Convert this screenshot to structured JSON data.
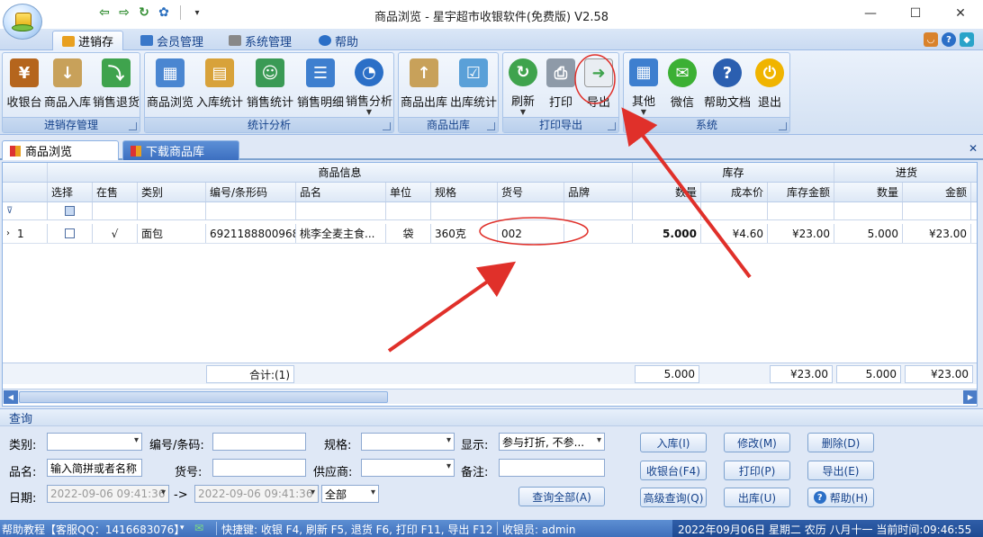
{
  "window": {
    "title": "商品浏览 - 星宇超市收银软件(免费版) V2.58",
    "minimize": "—",
    "maximize": "☐",
    "close": "✕"
  },
  "ribbon_tabs": [
    {
      "label": "进销存",
      "active": true
    },
    {
      "label": "会员管理",
      "active": false
    },
    {
      "label": "系统管理",
      "active": false
    },
    {
      "label": "帮助",
      "active": false
    }
  ],
  "ribbon_groups": {
    "jxc": {
      "label": "进销存管理",
      "buttons": [
        "收银台",
        "商品入库",
        "销售退货"
      ]
    },
    "stats": {
      "label": "统计分析",
      "buttons": [
        "商品浏览",
        "入库统计",
        "销售统计",
        "销售明细",
        "销售分析"
      ]
    },
    "out": {
      "label": "商品出库",
      "buttons": [
        "商品出库",
        "出库统计"
      ]
    },
    "print": {
      "label": "打印导出",
      "buttons": [
        "刷新",
        "打印",
        "导出"
      ]
    },
    "system": {
      "label": "系统",
      "buttons": [
        "其他",
        "微信",
        "帮助文档",
        "退出"
      ]
    }
  },
  "doc_tabs": [
    {
      "label": "商品浏览",
      "active": true
    },
    {
      "label": "下载商品库",
      "active": false
    }
  ],
  "grid": {
    "group_headers": {
      "info": "商品信息",
      "stock": "库存",
      "purchase": "进货"
    },
    "columns": [
      "选择",
      "在售",
      "类别",
      "编号/条形码",
      "品名",
      "单位",
      "规格",
      "货号",
      "品牌",
      "数量",
      "成本价",
      "库存金额",
      "数量",
      "金额"
    ],
    "rows": [
      {
        "index": "1",
        "on_sale": "√",
        "category": "面包",
        "barcode": "6921188800968",
        "name": "桃李全麦主食...",
        "unit": "袋",
        "spec": "360克",
        "item_no": "002",
        "brand": "",
        "stock_qty": "5.000",
        "cost": "¥4.60",
        "stock_amount": "¥23.00",
        "purchase_qty": "5.000",
        "purchase_amount": "¥23.00"
      }
    ],
    "footer": {
      "count": "合计:(1)",
      "stock_qty": "5.000",
      "stock_amount": "¥23.00",
      "purchase_qty": "5.000",
      "purchase_amount": "¥23.00"
    }
  },
  "query": {
    "title": "查询",
    "labels": {
      "category": "类别:",
      "barcode": "编号/条码:",
      "spec": "规格:",
      "display": "显示:",
      "name": "品名:",
      "item_no": "货号:",
      "supplier": "供应商:",
      "remark": "备注:",
      "date": "日期:",
      "arrow": "->"
    },
    "values": {
      "display": "参与打折, 不参...",
      "name_placeholder": "输入简拼或者名称",
      "date_from": "2022-09-06 09:41:36",
      "date_to": "2022-09-06 09:41:36",
      "range": "全部"
    },
    "buttons": {
      "query_all": "查询全部(A)",
      "stock_in": "入库(I)",
      "modify": "修改(M)",
      "delete": "删除(D)",
      "pos": "收银台(F4)",
      "print": "打印(P)",
      "export": "导出(E)",
      "advanced": "高级查询(Q)",
      "stock_out": "出库(U)",
      "help": "帮助(H)"
    }
  },
  "statusbar": {
    "help": "帮助教程【客服QQ：1416683076】",
    "shortcuts": "快捷键: 收银 F4, 刷新 F5, 退货 F6, 打印 F11, 导出 F12",
    "cashier": "收银员: admin",
    "datetime": "2022年09月06日 星期二 农历 八月十一 当前时间:09:46:55"
  },
  "colors": {
    "accent": "#15428b",
    "ribbon_bg": "#dfe8f6",
    "annotation": "#e0302a",
    "status_bg": "#3e6fbb"
  }
}
